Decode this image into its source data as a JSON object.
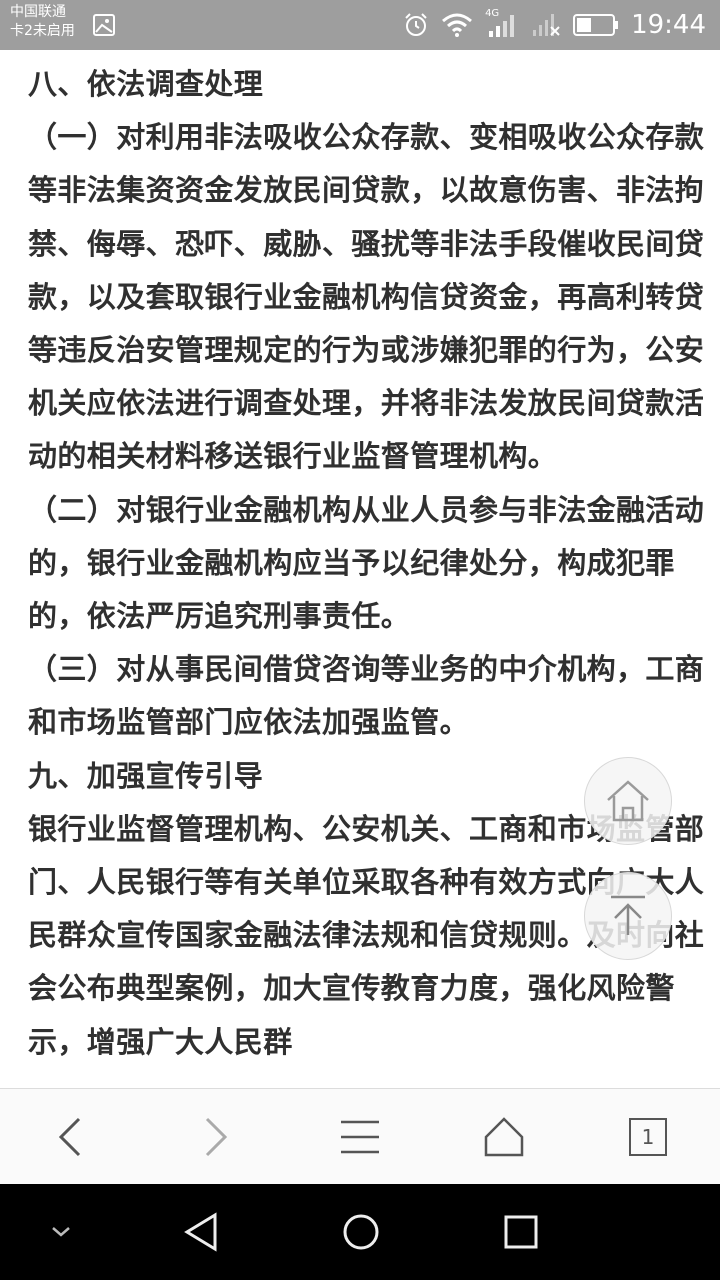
{
  "status_bar": {
    "carrier_line1": "中国联通",
    "carrier_line2": "卡2未启用",
    "network_type": "4G",
    "time": "19:44",
    "icons": [
      "gallery-icon",
      "alarm-icon",
      "wifi-icon",
      "signal-icon",
      "no-signal-icon",
      "battery-icon"
    ]
  },
  "article": {
    "paragraphs": [
      "八、依法调查处理",
      "（一）对利用非法吸收公众存款、变相吸收公众存款等非法集资资金发放民间贷款，以故意伤害、非法拘禁、侮辱、恐吓、威胁、骚扰等非法手段催收民间贷款，以及套取银行业金融机构信贷资金，再高利转贷等违反治安管理规定的行为或涉嫌犯罪的行为，公安机关应依法进行调查处理，并将非法发放民间贷款活动的相关材料移送银行业监督管理机构。",
      "（二）对银行业金融机构从业人员参与非法金融活动的，银行业金融机构应当予以纪律处分，构成犯罪的，依法严厉追究刑事责任。",
      "（三）对从事民间借贷咨询等业务的中介机构，工商和市场监管部门应依法加强监管。",
      "九、加强宣传引导",
      "银行业监督管理机构、公安机关、工商和市场监管部门、人民银行等有关单位采取各种有效方式向广大人民群众宣传国家金融法律法规和信贷规则。及时向社会公布典型案例，加大宣传教育力度，强化风险警示，增强广大人民群"
    ]
  },
  "floating": {
    "home_icon": "home-outline-icon",
    "top_icon": "arrow-up-icon"
  },
  "toolbar": {
    "tab_count": "1",
    "icons": [
      "back-arrow-icon",
      "forward-arrow-icon",
      "menu-icon",
      "home-icon",
      "tabs-icon"
    ]
  },
  "navbar": {
    "icons": [
      "collapse-chevron-icon",
      "back-triangle-icon",
      "home-circle-icon",
      "recents-square-icon"
    ]
  }
}
